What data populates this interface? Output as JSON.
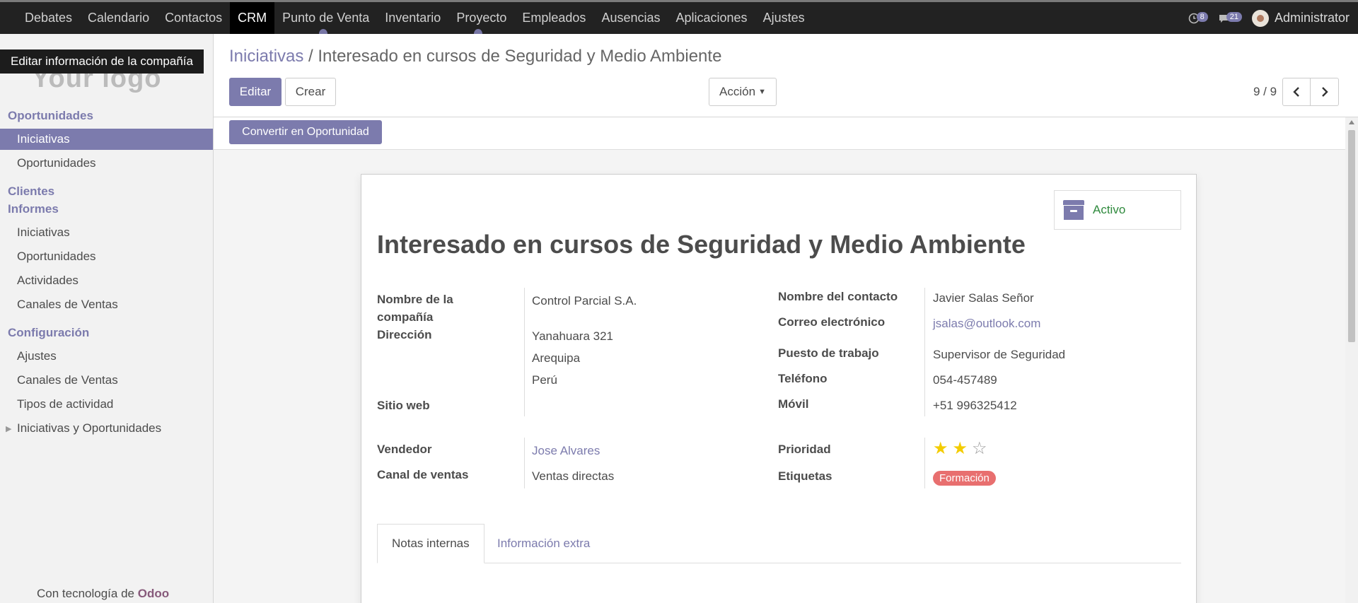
{
  "topbar": {
    "menus": [
      "Debates",
      "Calendario",
      "Contactos",
      "CRM",
      "Punto de Venta",
      "Inventario",
      "Proyecto",
      "Empleados",
      "Ausencias",
      "Aplicaciones",
      "Ajustes"
    ],
    "active_menu": "CRM",
    "activity_count": "8",
    "message_count": "21",
    "user_name": "Administrator"
  },
  "sidebar": {
    "tooltip": "Editar información de la compañía",
    "logo_text": "Your logo",
    "sections": {
      "oportunidades": "Oportunidades",
      "clientes": "Clientes",
      "informes": "Informes",
      "configuracion": "Configuración"
    },
    "items": {
      "iniciativas": "Iniciativas",
      "oportunidades": "Oportunidades",
      "inf_iniciativas": "Iniciativas",
      "inf_oportunidades": "Oportunidades",
      "inf_actividades": "Actividades",
      "inf_canales": "Canales de Ventas",
      "cfg_ajustes": "Ajustes",
      "cfg_canales": "Canales de Ventas",
      "cfg_tipos": "Tipos de actividad",
      "cfg_iniciativas_oport": "Iniciativas y Oportunidades"
    },
    "powered_prefix": "Con tecnología de",
    "powered_brand": "Odoo"
  },
  "control_panel": {
    "breadcrumb_parent": "Iniciativas",
    "breadcrumb_sep": "/",
    "breadcrumb_current": "Interesado en cursos de Seguridad y Medio Ambiente",
    "edit_label": "Editar",
    "create_label": "Crear",
    "action_label": "Acción",
    "pager": "9 / 9"
  },
  "statusbar": {
    "convert_label": "Convertir en Oportunidad"
  },
  "form": {
    "active_label": "Activo",
    "title": "Interesado en cursos de Seguridad y Medio Ambiente",
    "left": {
      "company_label": "Nombre de la compañía",
      "company_value": "Control Parcial S.A.",
      "address_label": "Dirección",
      "address_street": "Yanahuara 321",
      "address_city": "Arequipa",
      "address_country": "Perú",
      "website_label": "Sitio web",
      "salesperson_label": "Vendedor",
      "salesperson_value": "Jose Alvares",
      "channel_label": "Canal de ventas",
      "channel_value": "Ventas directas"
    },
    "right": {
      "contact_label": "Nombre del contacto",
      "contact_value": "Javier Salas Señor",
      "email_label": "Correo electrónico",
      "email_value": "jsalas@outlook.com",
      "job_label": "Puesto de trabajo",
      "job_value": "Supervisor de Seguridad",
      "phone_label": "Teléfono",
      "phone_value": "054-457489",
      "mobile_label": "Móvil",
      "mobile_value": "+51 996325412",
      "priority_label": "Prioridad",
      "priority_value": 2,
      "priority_max": 3,
      "tags_label": "Etiquetas",
      "tag_value": "Formación"
    },
    "tabs": {
      "notes": "Notas internas",
      "extra": "Información extra"
    }
  },
  "colors": {
    "accent": "#7c7bad",
    "topbar": "#222222",
    "tag": "#e86f6f",
    "active_green": "#2f8a3d",
    "star": "#f3cc00"
  }
}
